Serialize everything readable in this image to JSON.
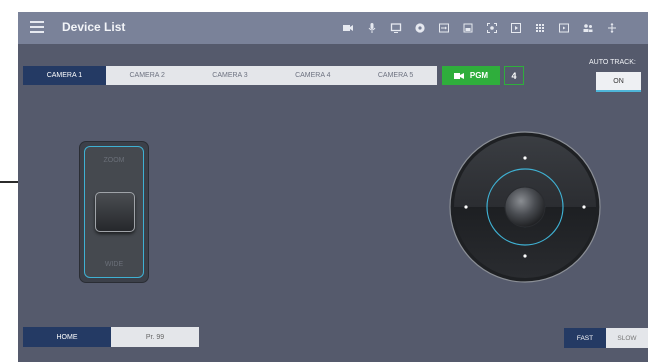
{
  "header": {
    "title": "Device List",
    "icons": [
      "camera-icon",
      "mic-icon",
      "monitor-icon",
      "settings-gear-icon",
      "input-icon",
      "storage-icon",
      "focus-icon",
      "play-icon",
      "grid-icon",
      "media-icon",
      "people-icon",
      "split-icon"
    ]
  },
  "cameras": {
    "tabs": [
      "CAMERA 1",
      "CAMERA 2",
      "CAMERA 3",
      "CAMERA 4",
      "CAMERA 5"
    ],
    "active_index": 0
  },
  "pgm": {
    "label": "PGM",
    "number": "4"
  },
  "auto_track": {
    "label": "AUTO TRACK:",
    "value": "ON"
  },
  "zoom": {
    "top_label": "ZOOM",
    "bottom_label": "WIDE"
  },
  "footer": {
    "home_label": "HOME",
    "preset_value": "Pr. 99",
    "speed_fast": "FAST",
    "speed_slow": "SLOW",
    "speed_selected": "FAST"
  },
  "colors": {
    "background": "#555a6c",
    "topbar": "#7a8299",
    "active_tab": "#243a64",
    "pgm_green": "#2fae3c",
    "accent_cyan": "#3fb1d3"
  }
}
